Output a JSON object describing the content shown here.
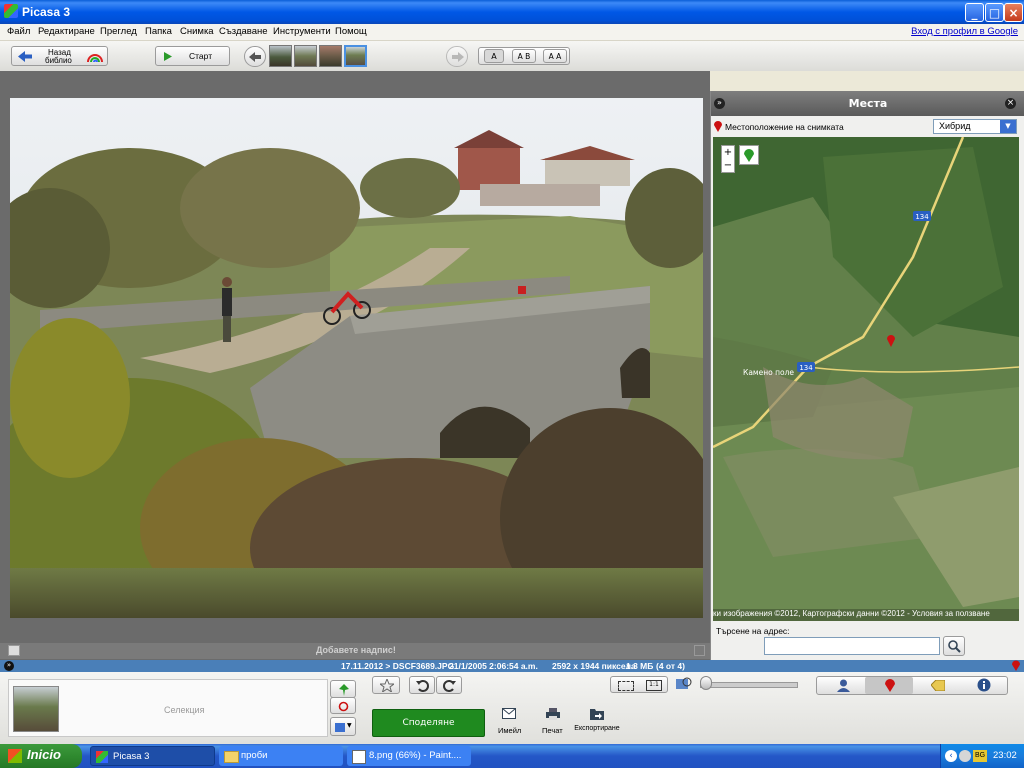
{
  "window": {
    "title": "Picasa 3",
    "signin_link": "Вход с профил в Google"
  },
  "menu": [
    "Файл",
    "Редактиране",
    "Преглед",
    "Папка",
    "Снимка",
    "Създаване",
    "Инструменти",
    "Помощ"
  ],
  "toolbar": {
    "back_label": "Назад към библиотеката",
    "back_label_short": "Назад",
    "back_label_short2": "библио",
    "slideshow_label": "Старт",
    "caption_mode_a": "A",
    "caption_mode_ab": "A B",
    "caption_mode_aa": "A A"
  },
  "photo": {
    "caption_placeholder": "Добавете надпис!"
  },
  "places": {
    "title": "Места",
    "location_label": "Местоположение на снимката",
    "map_type": "Хибрид",
    "road_number": "134",
    "road_number_2": "134",
    "town_label": "Камено поле",
    "copyright": "ки изображения ©2012, Картографски данни ©2012 - Условия за ползване",
    "search_label": "Търсене на адрес:",
    "search_value": ""
  },
  "status": {
    "date_file": "17.11.2012 > DSCF3689.JPG",
    "taken": "21/1/2005 2:06:54 a.m.",
    "dimensions": "2592 x 1944 пиксела",
    "size": "1.3 МБ",
    "index": "(4 от 4)"
  },
  "bottom": {
    "selection_label": "Селекция",
    "share_label": "Споделяне",
    "email_label": "Имейл",
    "print_label": "Печат",
    "export_label": "Експортиране"
  },
  "taskbar": {
    "start_label": "Inicio",
    "tasks": [
      "Picasa 3",
      "проби",
      "8.png (66%) - Paint...."
    ],
    "lang": "BG",
    "clock": "23:02"
  },
  "colors": {
    "share_green": "#1f8a1f",
    "status_blue": "#4a7fb8",
    "pin_red": "#cc1111"
  }
}
